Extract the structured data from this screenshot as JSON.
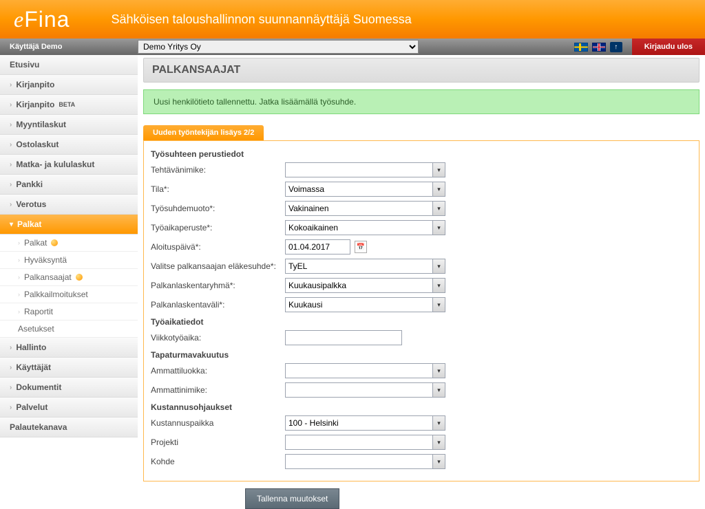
{
  "header": {
    "logo_prefix": "e",
    "logo_text": "Fina",
    "tagline": "Sähköisen taloushallinnon suunnannäyttäjä Suomessa"
  },
  "topbar": {
    "user_label": "Käyttäjä Demo",
    "company_value": "Demo Yritys Oy",
    "logout": "Kirjaudu ulos"
  },
  "sidebar": {
    "home": "Etusivu",
    "items": [
      "Kirjanpito",
      "Kirjanpito",
      "Myyntilaskut",
      "Ostolaskut",
      "Matka- ja kululaskut",
      "Pankki",
      "Verotus",
      "Palkat"
    ],
    "beta": "BETA",
    "palkat_sub": [
      "Palkat",
      "Hyväksyntä",
      "Palkansaajat",
      "Palkkailmoitukset",
      "Raportit",
      "Asetukset"
    ],
    "after": [
      "Hallinto",
      "Käyttäjät",
      "Dokumentit",
      "Palvelut",
      "Palautekanava"
    ]
  },
  "page": {
    "title": "PALKANSAAJAT",
    "success": "Uusi henkilötieto tallennettu. Jatka lisäämällä työsuhde.",
    "tab": "Uuden työntekijän lisäys 2/2"
  },
  "form": {
    "sections": {
      "s1": "Työsuhteen perustiedot",
      "s2": "Työaikatiedot",
      "s3": "Tapaturmavakuutus",
      "s4": "Kustannusohjaukset"
    },
    "rows": {
      "tehtavanimike": {
        "label": "Tehtävänimike:",
        "value": ""
      },
      "tila": {
        "label": "Tila*:",
        "value": "Voimassa"
      },
      "tyosuhdemuoto": {
        "label": "Työsuhdemuoto*:",
        "value": "Vakinainen"
      },
      "tyoaikaperuste": {
        "label": "Työaikaperuste*:",
        "value": "Kokoaikainen"
      },
      "aloituspaiva": {
        "label": "Aloituspäivä*:",
        "value": "01.04.2017"
      },
      "elakesuhde": {
        "label": "Valitse palkansaajan eläkesuhde*:",
        "value": "TyEL"
      },
      "palkanlaskentaryhma": {
        "label": "Palkanlaskentaryhmä*:",
        "value": "Kuukausipalkka"
      },
      "palkanlaskentavali": {
        "label": "Palkanlaskentaväli*:",
        "value": "Kuukausi"
      },
      "viikkotyoaika": {
        "label": "Viikkotyöaika:",
        "value": ""
      },
      "ammattiluokka": {
        "label": "Ammattiluokka:",
        "value": ""
      },
      "ammattinimike": {
        "label": "Ammattinimike:",
        "value": ""
      },
      "kustannuspaikka": {
        "label": "Kustannuspaikka",
        "value": "100 - Helsinki"
      },
      "projekti": {
        "label": "Projekti",
        "value": ""
      },
      "kohde": {
        "label": "Kohde",
        "value": ""
      }
    },
    "save": "Tallenna muutokset"
  }
}
